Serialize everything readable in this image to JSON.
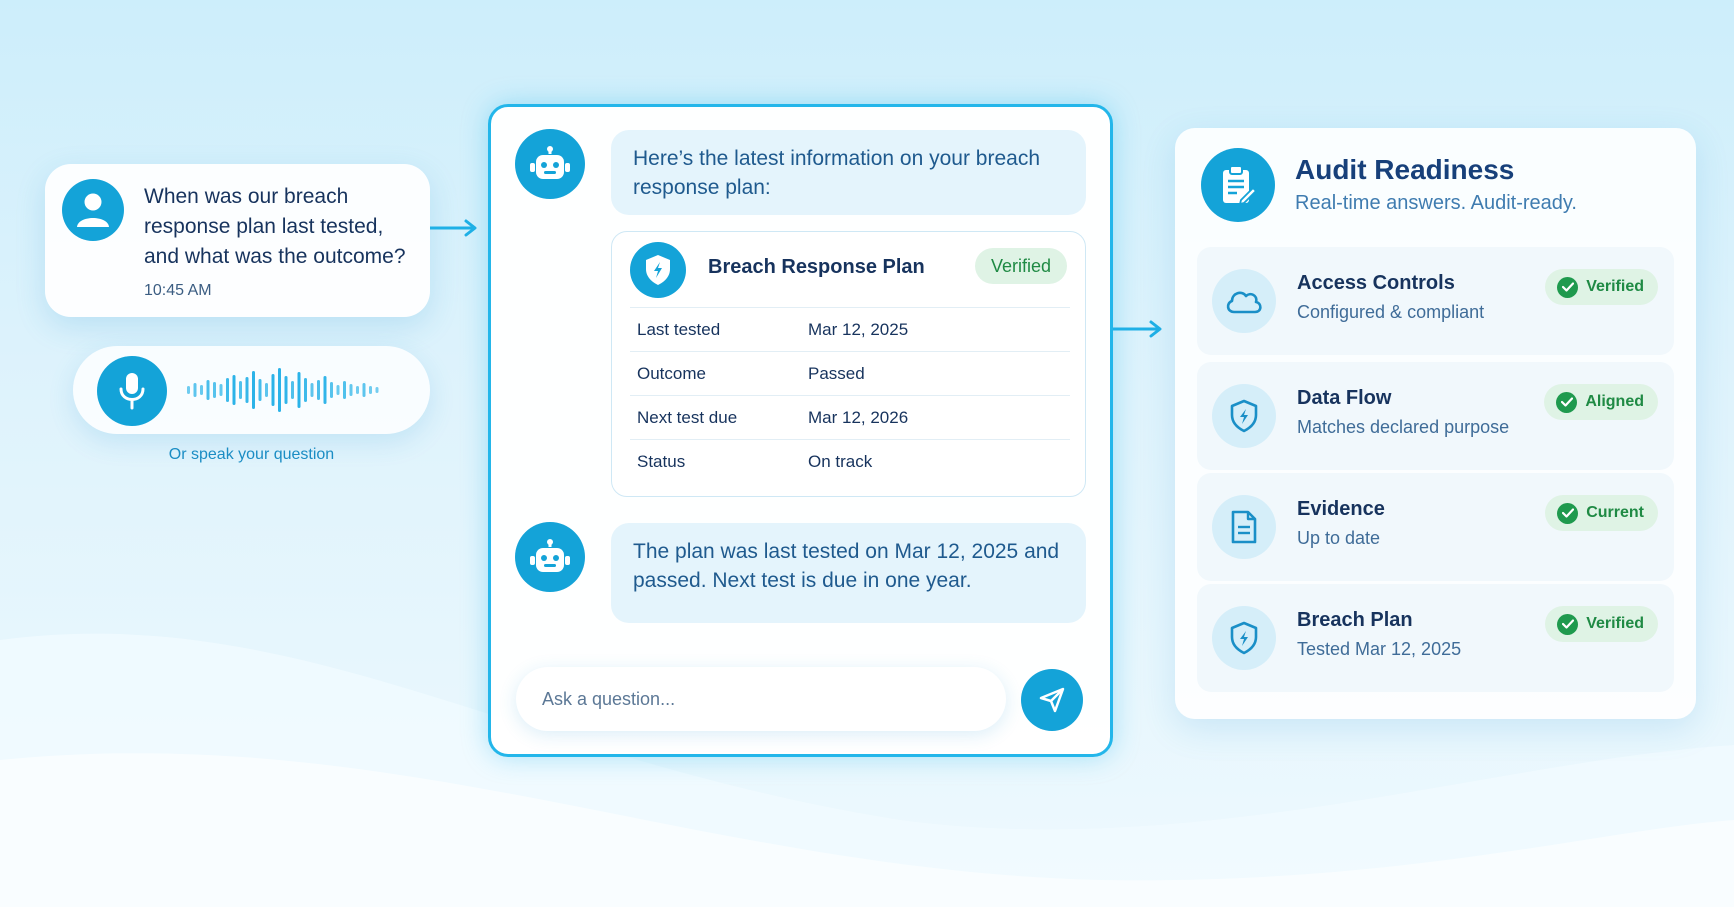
{
  "question": {
    "text": "When was our breach response plan last tested, and what was the outcome?",
    "time": "10:45 AM",
    "voice_caption": "Or speak your question"
  },
  "chat": {
    "intro": "Here’s the latest information on your breach response plan:",
    "plan_card": {
      "title": "Breach Response Plan",
      "badge": "Verified",
      "rows": [
        {
          "label": "Last tested",
          "value": "Mar 12, 2025"
        },
        {
          "label": "Outcome",
          "value": "Passed"
        },
        {
          "label": "Next test due",
          "value": "Mar 12, 2026"
        },
        {
          "label": "Status",
          "value": "On track"
        }
      ]
    },
    "answer": "The plan was last tested on Mar 12, 2025 and passed. Next test is due in one year.",
    "input_placeholder": "Ask a question..."
  },
  "audit": {
    "title": "Audit Readiness",
    "subtitle": "Real-time answers. Audit-ready.",
    "items": [
      {
        "icon": "cloud-icon",
        "title": "Access Controls",
        "subtitle": "Configured & compliant",
        "status": "Verified"
      },
      {
        "icon": "shield-icon",
        "title": "Data Flow",
        "subtitle": "Matches declared purpose",
        "status": "Aligned"
      },
      {
        "icon": "document-icon",
        "title": "Evidence",
        "subtitle": "Up to date",
        "status": "Current"
      },
      {
        "icon": "shield-icon",
        "title": "Breach Plan",
        "subtitle": "Tested Mar 12, 2025",
        "status": "Verified"
      }
    ]
  },
  "colors": {
    "accent": "#14a3d8",
    "frame": "#23b6ea",
    "success_bg": "#dff3e5",
    "success_text": "#1f8a44"
  }
}
